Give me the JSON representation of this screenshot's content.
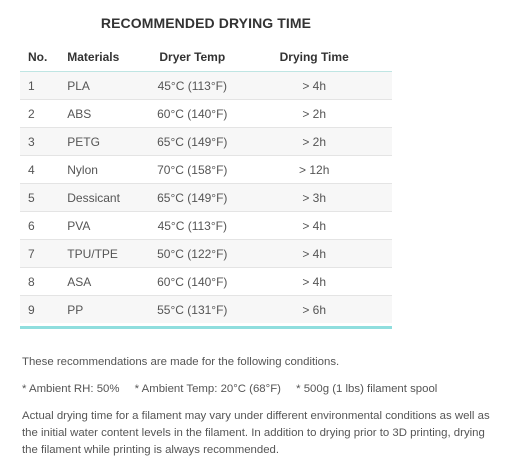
{
  "title": "RECOMMENDED DRYING TIME",
  "table": {
    "headers": [
      "No.",
      "Materials",
      "Dryer Temp",
      "Drying Time"
    ],
    "rows": [
      [
        "1",
        "PLA",
        "45°C (113°F)",
        "> 4h"
      ],
      [
        "2",
        "ABS",
        "60°C (140°F)",
        "> 2h"
      ],
      [
        "3",
        "PETG",
        "65°C (149°F)",
        "> 2h"
      ],
      [
        "4",
        "Nylon",
        "70°C (158°F)",
        "> 12h"
      ],
      [
        "5",
        "Dessicant",
        "65°C (149°F)",
        "> 3h"
      ],
      [
        "6",
        "PVA",
        "45°C (113°F)",
        "> 4h"
      ],
      [
        "7",
        "TPU/TPE",
        "50°C (122°F)",
        "> 4h"
      ],
      [
        "8",
        "ASA",
        "60°C (140°F)",
        "> 4h"
      ],
      [
        "9",
        "PP",
        "55°C (131°F)",
        "> 6h"
      ]
    ]
  },
  "notes": {
    "intro": "These recommendations are made for the following conditions.",
    "conditions": [
      "* Ambient RH: 50%",
      "* Ambient Temp: 20°C (68°F)",
      "* 500g (1 lbs) filament spool"
    ],
    "detail": "Actual drying time for a filament may vary under different environmental conditions as well as the initial water content levels in the filament.  In addition to drying prior to 3D printing, drying the filament while printing is always recommended."
  },
  "colors": {
    "accent_rule": "#8fdede",
    "row_alt": "#f7f7f7",
    "heading_text": "#333333",
    "body_text": "#555555"
  }
}
